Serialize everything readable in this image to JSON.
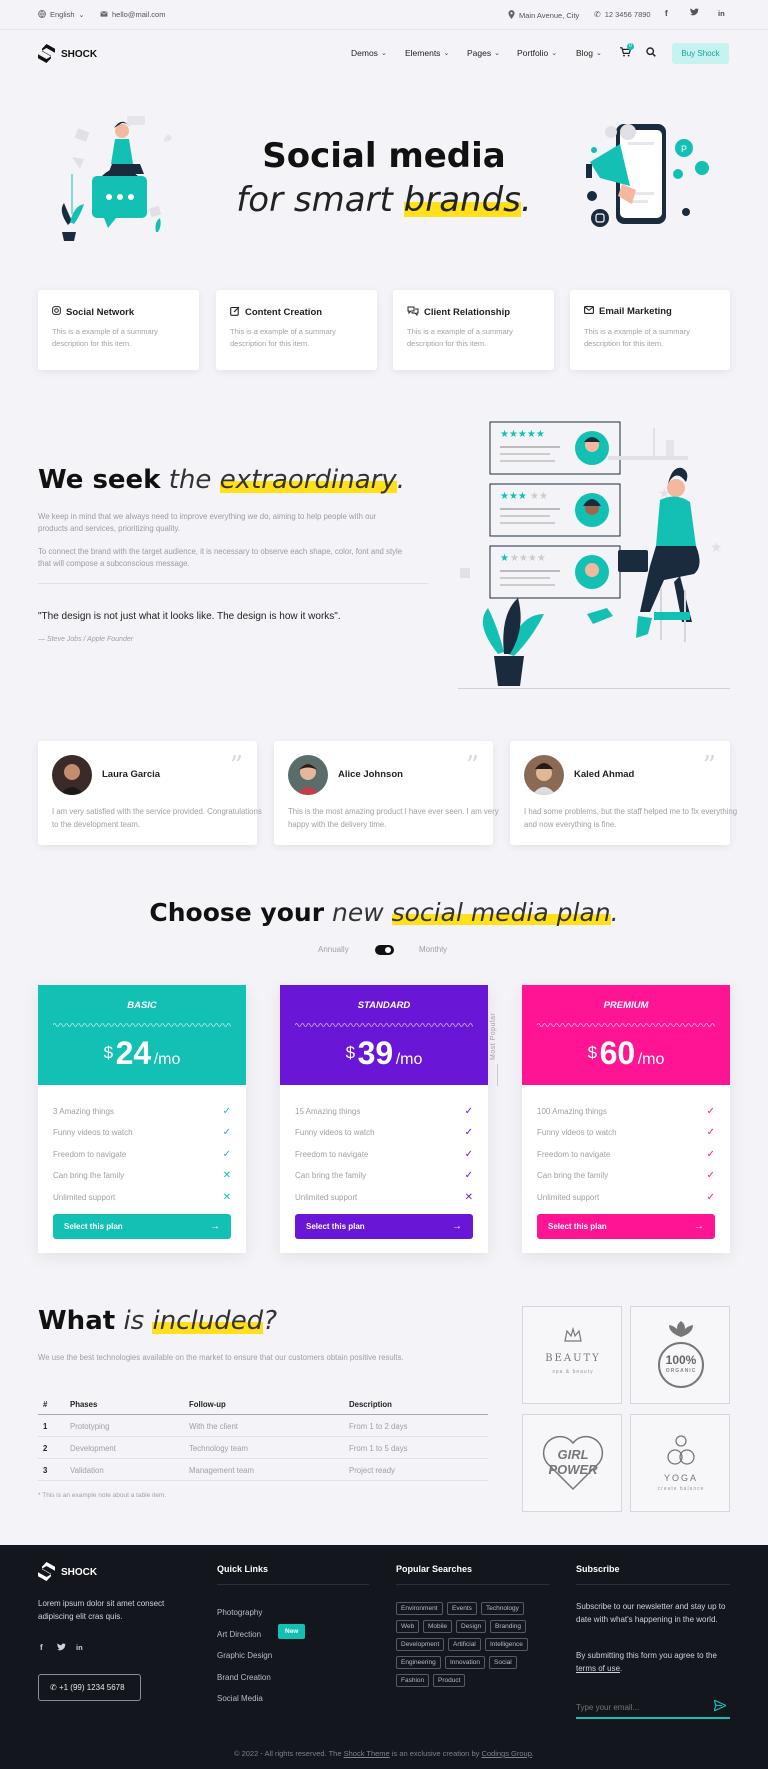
{
  "topbar": {
    "language": "English",
    "email": "hello@mail.com",
    "address": "Main Avenue, City",
    "phone": "12 3456 7890"
  },
  "header": {
    "logo": "SHOCK",
    "nav": [
      "Demos",
      "Elements",
      "Pages",
      "Portfolio",
      "Blog"
    ],
    "cart_count": "0",
    "buy_label": "Buy Shock"
  },
  "hero": {
    "title": "Social media",
    "subtitle_pre": "for smart ",
    "subtitle_hl": "brands",
    "subtitle_post": "."
  },
  "services": [
    {
      "title": "Social Network",
      "desc": "This is a example of a summary description for this item."
    },
    {
      "title": "Content Creation",
      "desc": "This is a example of a summary description for this item."
    },
    {
      "title": "Client Relationship",
      "desc": "This is a example of a summary description for this item."
    },
    {
      "title": "Email Marketing",
      "desc": "This is a example of a summary description for this item."
    }
  ],
  "seek": {
    "title_bold": "We seek",
    "title_light": "the ",
    "title_hl": "extraordinary",
    "title_end": ".",
    "p1": "We keep in mind that we always need to improve everything we do, aiming to help people with our products and services, prioritizing quality.",
    "p2": "To connect the brand with the target audience, it is necessary to observe each shape, color, font and style that will compose a subconscious message.",
    "quote": "\"The design is not just what it looks like. The design is how it works\".",
    "author": "— Steve Jobs / Apple Founder"
  },
  "testimonials": [
    {
      "name": "Laura Garcia",
      "text": "I am very satisfied with the service provided. Congratulations to the development team."
    },
    {
      "name": "Alice Johnson",
      "text": "This is the most amazing product I have ever seen. I am very happy with the delivery time."
    },
    {
      "name": "Kaled Ahmad",
      "text": "I had some problems, but the staff helped me to fix everything and now everything is fine."
    }
  ],
  "pricing": {
    "title_bold": "Choose your",
    "title_light": "new ",
    "title_hl": "social media plan",
    "title_end": ".",
    "toggle_left": "Annually",
    "toggle_right": "Monthly",
    "most_popular": "Most Popular",
    "currency": "$",
    "per": "/mo",
    "features": [
      "Amazing things",
      "Funny videos to watch",
      "Freedom to navigate",
      "Can bring the family",
      "Unlimited support"
    ],
    "select_label": "Select this plan",
    "plans": [
      {
        "name": "BASIC",
        "price": "24",
        "things": "3 Amazing things",
        "color": "#13c0b4",
        "checks": [
          true,
          true,
          true,
          false,
          false
        ]
      },
      {
        "name": "STANDARD",
        "price": "39",
        "things": "15 Amazing things",
        "color": "#6a16d6",
        "checks": [
          true,
          true,
          true,
          true,
          false
        ]
      },
      {
        "name": "PREMIUM",
        "price": "60",
        "things": "100 Amazing things",
        "color": "#ff1493",
        "checks": [
          true,
          true,
          true,
          true,
          true
        ]
      }
    ]
  },
  "included": {
    "title_bold": "What",
    "title_light": "is ",
    "title_hl": "included",
    "title_end": "?",
    "desc": "We use the best technologies available on the market to ensure that our customers obtain positive results.",
    "headers": [
      "#",
      "Phases",
      "Follow-up",
      "Description"
    ],
    "rows": [
      [
        "1",
        "Prototyping",
        "With the client",
        "From 1 to 2 days"
      ],
      [
        "2",
        "Development",
        "Technology team",
        "From 1 to 5 days"
      ],
      [
        "3",
        "Validation",
        "Management team",
        "Project ready"
      ]
    ],
    "note": "* This is an example note about a table item.",
    "logos": [
      {
        "line1": "BEAUTY",
        "line2": "spa & beauty"
      },
      {
        "line1": "100%",
        "line2": "ORGANIC"
      },
      {
        "line1": "GIRL",
        "line2": "POWER"
      },
      {
        "line1": "YOGA",
        "line2": "create balance"
      }
    ]
  },
  "footer": {
    "logo": "SHOCK",
    "about": "Lorem ipsum dolor sit amet consect adipiscing elit cras quis.",
    "phone": "+1 (99) 1234 5678",
    "quick_title": "Quick Links",
    "links": [
      "Photography",
      "Art Direction",
      "Graphic Design",
      "Brand Creation",
      "Social Media"
    ],
    "new_badge": "New",
    "popular_title": "Popular Searches",
    "tags": [
      [
        "Environment",
        "Events",
        "Technology"
      ],
      [
        "Web",
        "Mobile",
        "Design",
        "Branding"
      ],
      [
        "Development",
        "Artificial",
        "Intelligence"
      ],
      [
        "Engineering",
        "Innovation",
        "Social"
      ],
      [
        "Fashion",
        "Product"
      ]
    ],
    "subscribe_title": "Subscribe",
    "subscribe_text": "Subscribe to our newsletter and stay up to date with what's happening in the world.",
    "terms_pre": "By submitting this form you agree to the ",
    "terms_link": "terms of use",
    "terms_post": ".",
    "email_placeholder": "Type your email...",
    "copyright_pre": "© 2022 - All rights reserved. The ",
    "copyright_link1": "Shock Theme",
    "copyright_mid": " is an exclusive creation by ",
    "copyright_link2": "Codings Group",
    "copyright_end": "."
  }
}
